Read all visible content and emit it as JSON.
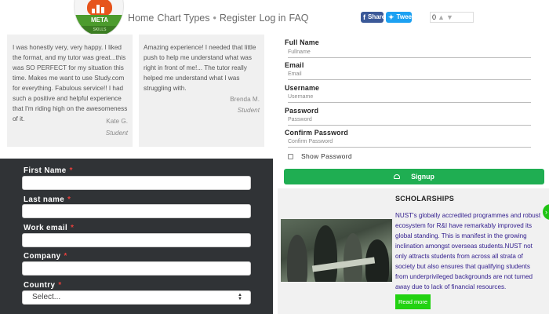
{
  "header": {
    "logo": {
      "title": "META",
      "subtitle": "SKILLS"
    },
    "nav": [
      "Home",
      "Chart Types",
      "Register",
      "Log in",
      "FAQ"
    ],
    "nav_separator": "•",
    "share": {
      "facebook_label": "Share",
      "twitter_label": "Tweet"
    },
    "votes": {
      "count": "0"
    }
  },
  "testimonials": [
    {
      "text": "I was honestly very, very happy. I liked the format, and my tutor was great...this was SO PERFECT for my situation this time. Makes me want to use Study.com for everything. Fabulous service!! I had such a positive and helpful experience that I'm riding high on the awesomeness of it.",
      "author": "Kate G.",
      "role": "Student"
    },
    {
      "text": "Amazing experience! I needed that little push to help me understand what was right in front of me!... The tutor really helped me understand what I was struggling with.",
      "author": "Brenda M.",
      "role": "Student"
    }
  ],
  "lead_form": {
    "fields": [
      {
        "label": "First Name",
        "required": "*"
      },
      {
        "label": "Last name",
        "required": "*"
      },
      {
        "label": "Work email",
        "required": "*"
      },
      {
        "label": "Company",
        "required": "*"
      },
      {
        "label": "Country",
        "required": "*"
      }
    ],
    "country_value": "Select..."
  },
  "register_form": {
    "fields": [
      {
        "label": "Full Name",
        "placeholder": "Fullname"
      },
      {
        "label": "Email",
        "placeholder": "Email"
      },
      {
        "label": "Username",
        "placeholder": "Username"
      },
      {
        "label": "Password",
        "placeholder": "Password"
      },
      {
        "label": "Confirm Password",
        "placeholder": "Confirm Password"
      }
    ],
    "show_password_label": "Show Password",
    "signup_label": "Signup"
  },
  "scholarships": {
    "title": "SCHOLARSHIPS",
    "text": "NUST's globally accredited programmes and robust ecosystem for R&I have remarkably improved its global standing. This is manifest in the growing inclination amongst overseas students.NUST not only attracts students from across all strata of society but also ensures that qualifying students from underprivileged backgrounds are not turned away due to lack of financial resources.",
    "read_more_label": "Read more"
  },
  "colors": {
    "brand_green": "#1fae52",
    "read_more_green": "#22d211",
    "dark_panel": "#303336",
    "required_red": "#e8403c",
    "facebook": "#3b5998",
    "twitter": "#1da1f2",
    "scholarship_text": "#2f1b8c"
  }
}
